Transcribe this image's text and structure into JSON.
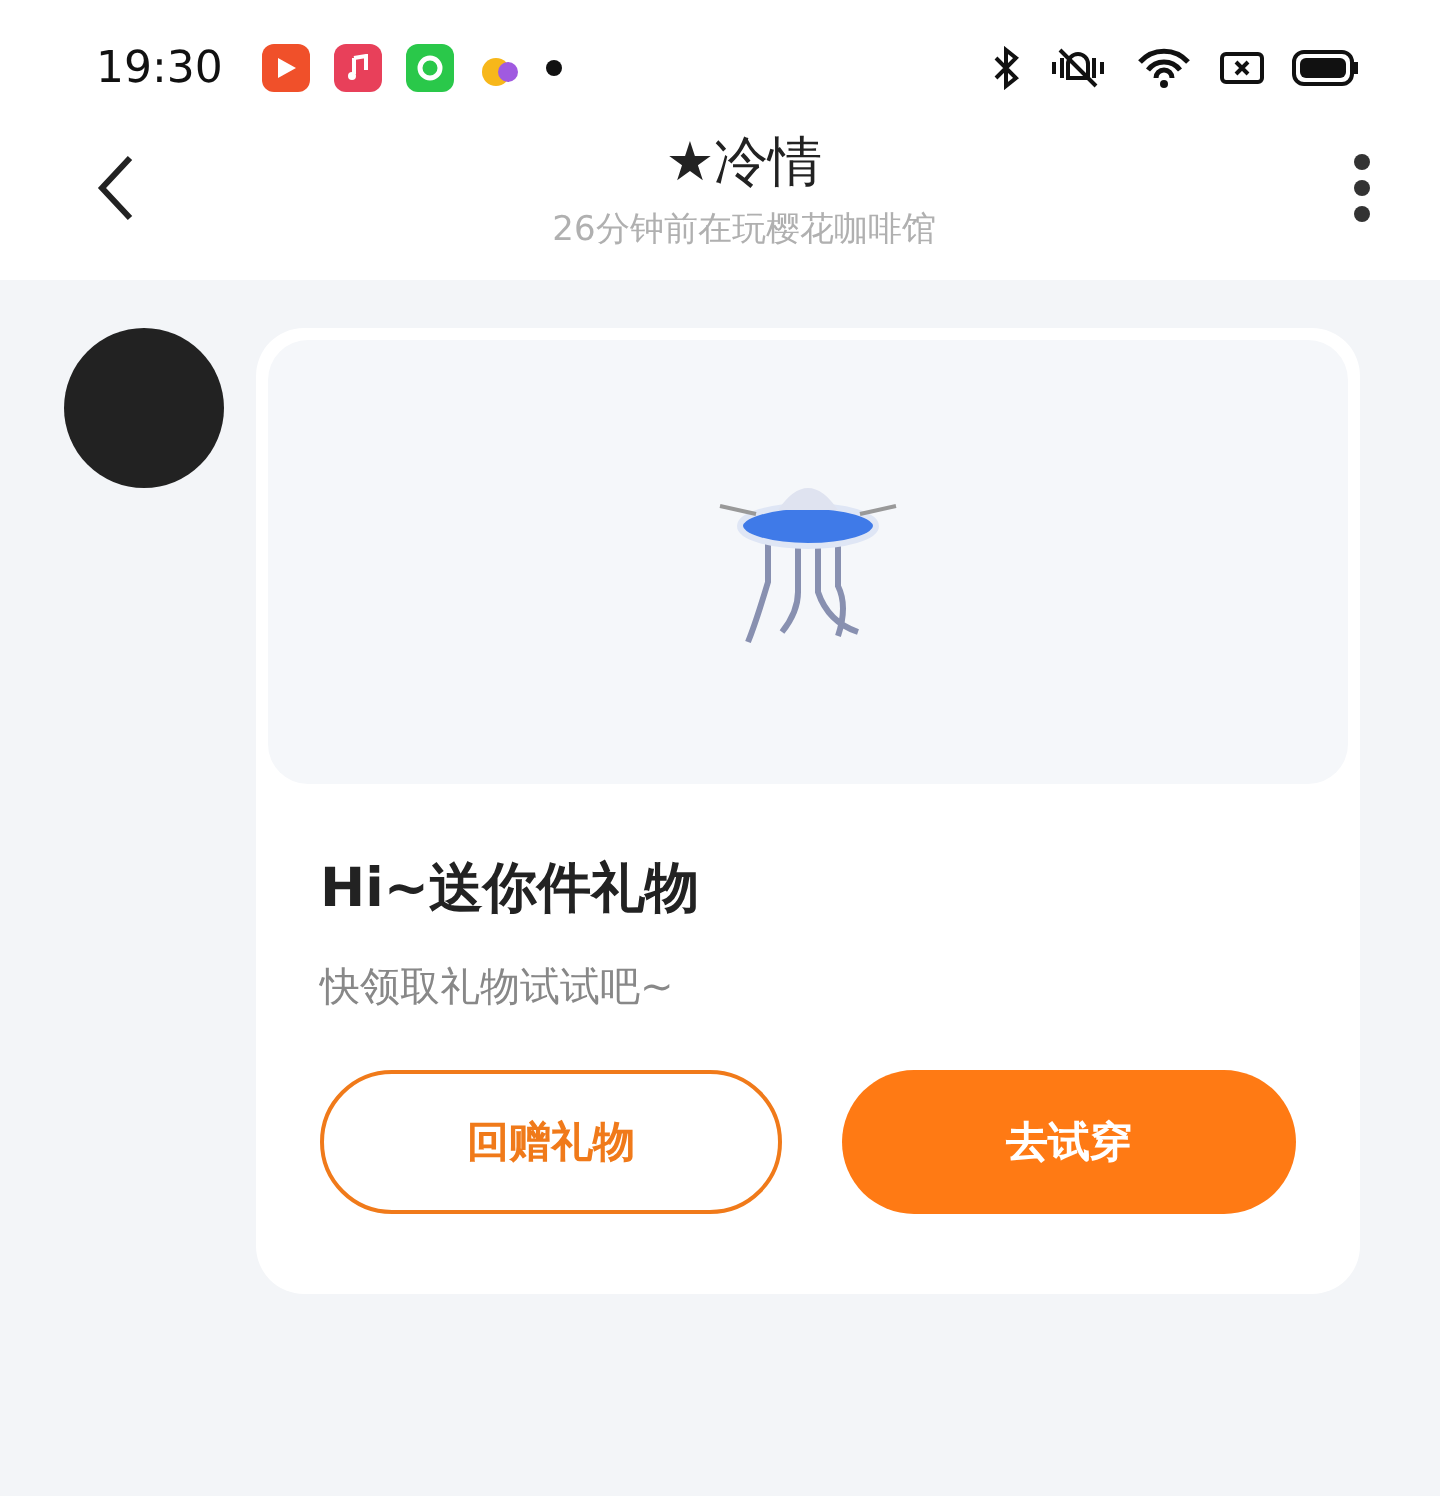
{
  "status_bar": {
    "time": "19:30"
  },
  "header": {
    "title": "★冷情",
    "subtitle": "26分钟前在玩樱花咖啡馆"
  },
  "message": {
    "title": "Hi~送你件礼物",
    "text": "快领取礼物试试吧~",
    "buttons": [
      {
        "label": "回赠礼物",
        "kind": "outline"
      },
      {
        "label": "去试穿",
        "kind": "filled"
      }
    ]
  }
}
